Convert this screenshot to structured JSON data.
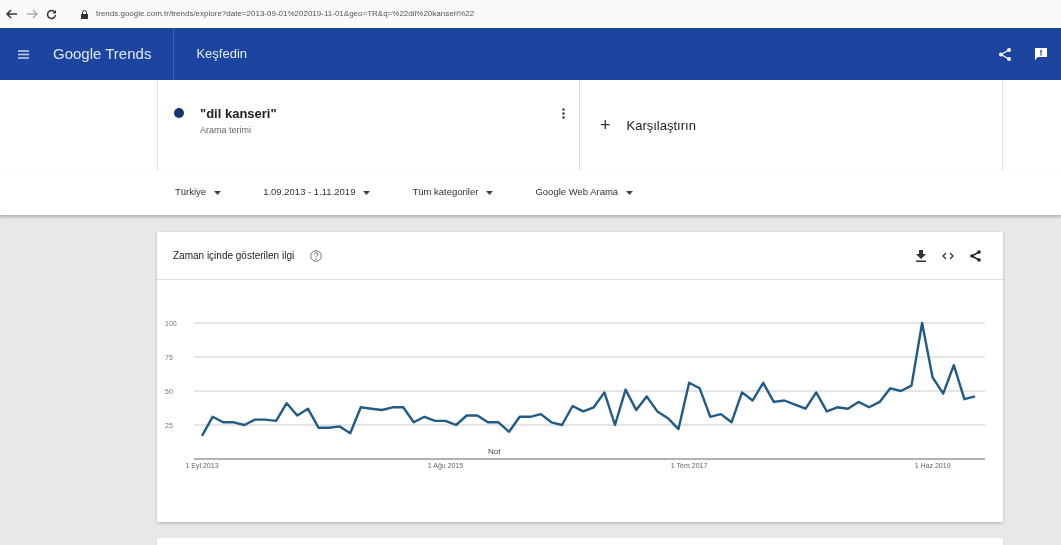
{
  "browser": {
    "url": "trends.google.com.tr/trends/explore?date=2013-09-01%202019-11-01&geo=TR&q=%22dil%20kanseri%22"
  },
  "header": {
    "logo": "Google Trends",
    "section": "Keşfedin"
  },
  "terms": [
    {
      "label": "\"dil kanseri\"",
      "sublabel": "Arama terimi",
      "color": "#16336e"
    }
  ],
  "compare": {
    "label": "Karşılaştırın",
    "icon": "+"
  },
  "filters": [
    "Türkiye",
    "1.09.2013 - 1.11.2019",
    "Tüm kategoriler",
    "Google Web Arama"
  ],
  "interest_card": {
    "title": "Zaman içinde gösterilen ilgi",
    "chart_data": {
      "type": "line",
      "categories": [
        "1 Eyl 2013",
        null,
        null,
        null,
        null,
        null,
        null,
        null,
        null,
        null,
        null,
        null,
        null,
        null,
        null,
        null,
        null,
        null,
        null,
        null,
        null,
        null,
        null,
        "1 Ağu 2015",
        null,
        null,
        null,
        null,
        null,
        null,
        null,
        null,
        null,
        null,
        null,
        null,
        null,
        null,
        null,
        null,
        null,
        null,
        null,
        null,
        null,
        null,
        "1 Tem 2017",
        null,
        null,
        null,
        null,
        null,
        null,
        null,
        null,
        null,
        null,
        null,
        null,
        null,
        null,
        null,
        null,
        null,
        null,
        null,
        null,
        null,
        null,
        "1 Haz 2019",
        null,
        null,
        null,
        null
      ],
      "series": [
        {
          "color": "#1f5b86",
          "values": [
            17,
            31,
            27,
            27,
            25,
            29,
            29,
            28,
            41,
            32,
            37,
            23,
            23,
            24,
            19,
            38,
            37,
            36,
            38,
            38,
            27,
            31,
            28,
            28,
            25,
            32,
            32,
            27,
            27,
            20,
            31,
            31,
            33,
            27,
            25,
            39,
            35,
            38,
            49,
            25,
            51,
            36,
            46,
            35,
            30,
            22,
            56,
            52,
            31,
            33,
            27,
            49,
            43,
            56,
            42,
            43,
            40,
            37,
            49,
            35,
            38,
            37,
            42,
            38,
            42,
            52,
            50,
            54,
            100,
            60,
            48,
            69,
            44,
            46
          ]
        }
      ],
      "ylim": [
        0,
        100
      ],
      "yticks": [
        25,
        50,
        75,
        100
      ],
      "grid": true,
      "annotations": [
        "Not"
      ]
    }
  }
}
